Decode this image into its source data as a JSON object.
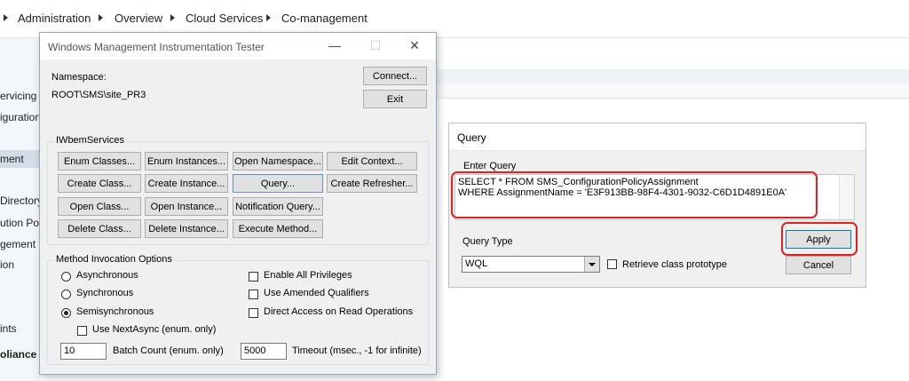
{
  "breadcrumb": {
    "items": [
      "Administration",
      "Overview",
      "Cloud Services",
      "Co-management"
    ]
  },
  "left_nav": {
    "items": [
      "ervicing",
      "iguration",
      "ment",
      "Directory",
      "ution Po",
      "gement G",
      "ion",
      "ints"
    ],
    "section": "oliance"
  },
  "wmi_window": {
    "title": "Windows Management Instrumentation Tester",
    "namespace_label": "Namespace:",
    "namespace_value": "ROOT\\SMS\\site_PR3",
    "connect_label": "Connect...",
    "exit_label": "Exit",
    "services_group": {
      "title": "IWbemServices",
      "buttons": [
        "Enum Classes...",
        "Enum Instances...",
        "Open Namespace...",
        "Edit Context...",
        "Create Class...",
        "Create Instance...",
        "Query...",
        "Create Refresher...",
        "Open Class...",
        "Open Instance...",
        "Notification Query...",
        "Delete Class...",
        "Delete Instance...",
        "Execute Method..."
      ]
    },
    "method_group": {
      "title": "Method Invocation Options",
      "radios": [
        {
          "label": "Asynchronous",
          "checked": false
        },
        {
          "label": "Synchronous",
          "checked": false
        },
        {
          "label": "Semisynchronous",
          "checked": true
        }
      ],
      "use_next_async": "Use NextAsync (enum. only)",
      "checkboxes": [
        "Enable All Privileges",
        "Use Amended Qualifiers",
        "Direct Access on Read Operations"
      ],
      "batch_value": "10",
      "batch_label": "Batch Count (enum. only)",
      "timeout_value": "5000",
      "timeout_label": "Timeout (msec., -1 for infinite)"
    }
  },
  "query_dialog": {
    "title": "Query",
    "enter_query_label": "Enter Query",
    "query_line1": "SELECT * FROM SMS_ConfigurationPolicyAssignment",
    "query_line2": "WHERE AssignmentName = 'E3F913BB-98F4-4301-9032-C6D1D4891E0A'",
    "query_type_label": "Query Type",
    "query_type_value": "WQL",
    "retrieve_label": "Retrieve class prototype",
    "apply_label": "Apply",
    "cancel_label": "Cancel"
  },
  "colors": {
    "highlight": "#dd2222",
    "window_bg": "#f0f0f0"
  }
}
